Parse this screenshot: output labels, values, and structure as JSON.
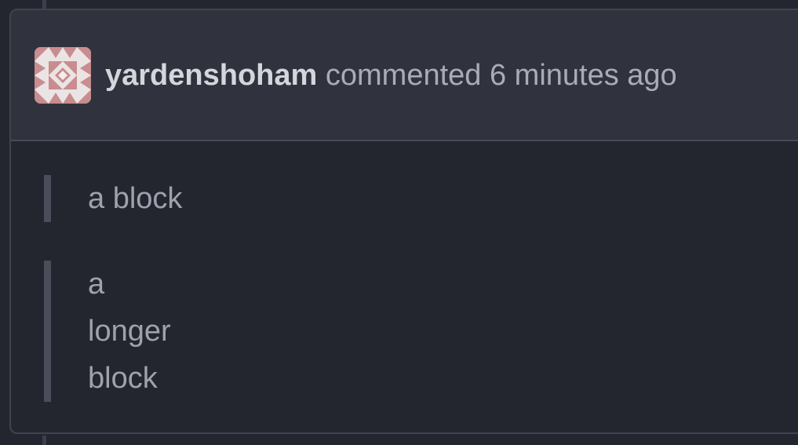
{
  "comment": {
    "author": "yardenshoham",
    "action_text": "commented",
    "timestamp": "6 minutes ago",
    "avatar_icon": "identicon-avatar",
    "avatar_color": "#c98c8f"
  },
  "body": {
    "quotes": [
      {
        "lines": [
          "a block"
        ]
      },
      {
        "lines": [
          "a",
          "longer",
          "block"
        ]
      }
    ]
  },
  "colors": {
    "page_bg": "#23252f",
    "header_bg": "#30333d",
    "border": "#41444f",
    "quote_bar": "#4a4e5b",
    "text_muted": "#a9acb6",
    "text_strong": "#d4d6dc"
  }
}
